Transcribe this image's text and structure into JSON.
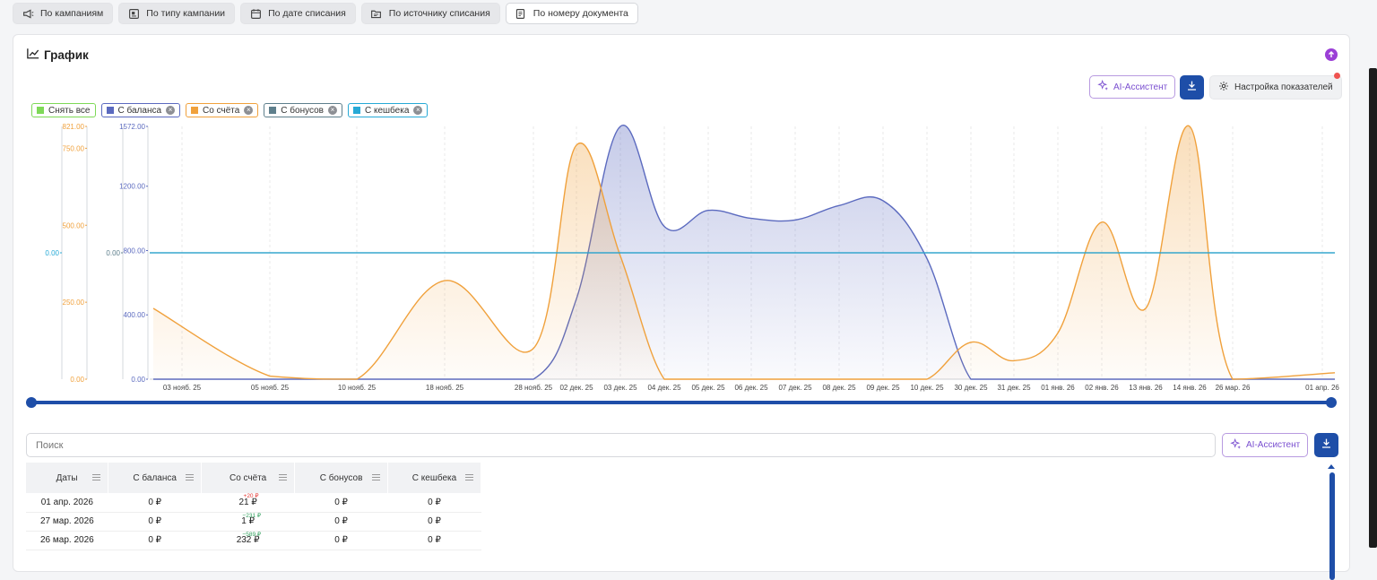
{
  "tabs": [
    {
      "label": "По кампаниям",
      "icon": "megaphone-icon",
      "active": false
    },
    {
      "label": "По типу кампании",
      "icon": "campaign-type-icon",
      "active": false
    },
    {
      "label": "По дате списания",
      "icon": "calendar-icon",
      "active": false
    },
    {
      "label": "По источнику списания",
      "icon": "folder-icon",
      "active": false
    },
    {
      "label": "По номеру документа",
      "icon": "document-icon",
      "active": true
    }
  ],
  "card": {
    "title": "График",
    "ai_label": "AI-Ассистент",
    "settings_label": "Настройка показателей"
  },
  "legend": {
    "deselect_all": "Снять все",
    "items": [
      {
        "label": "С баланса",
        "color": "#5b6abf"
      },
      {
        "label": "Со счёта",
        "color": "#f0a13c"
      },
      {
        "label": "С бонусов",
        "color": "#5e7f8c"
      },
      {
        "label": "С кешбека",
        "color": "#26a9d6"
      }
    ],
    "deselect_color": "#7ed957"
  },
  "chart_data": {
    "type": "area",
    "x": [
      "03 нояб. 25",
      "05 нояб. 25",
      "10 нояб. 25",
      "18 нояб. 25",
      "28 нояб. 25",
      "02 дек. 25",
      "03 дек. 25",
      "04 дек. 25",
      "05 дек. 25",
      "06 дек. 25",
      "07 дек. 25",
      "08 дек. 25",
      "09 дек. 25",
      "10 дек. 25",
      "30 дек. 25",
      "31 дек. 25",
      "01 янв. 26",
      "02 янв. 26",
      "13 янв. 26",
      "14 янв. 26",
      "26 мар. 26",
      "01 апр. 26"
    ],
    "series": [
      {
        "name": "С баланса",
        "color": "#5b6abf",
        "axis": "y2",
        "values": [
          0,
          0,
          0,
          0,
          0,
          500,
          1572,
          950,
          1050,
          1000,
          990,
          1080,
          1110,
          750,
          0,
          0,
          0,
          0,
          0,
          0,
          0,
          0
        ]
      },
      {
        "name": "Со счёта",
        "color": "#f0a13c",
        "axis": "y1",
        "values": [
          230,
          10,
          0,
          320,
          100,
          760,
          400,
          0,
          0,
          0,
          0,
          0,
          0,
          0,
          120,
          60,
          150,
          510,
          230,
          821,
          0,
          21
        ]
      },
      {
        "name": "С бонусов",
        "color": "#5e7f8c",
        "axis": "y3",
        "values": [
          0,
          0,
          0,
          0,
          0,
          0,
          0,
          0,
          0,
          0,
          0,
          0,
          0,
          0,
          0,
          0,
          0,
          0,
          0,
          0,
          0,
          0
        ]
      },
      {
        "name": "С кешбека",
        "color": "#26a9d6",
        "axis": "y4",
        "values": [
          0,
          0,
          0,
          0,
          0,
          0,
          0,
          0,
          0,
          0,
          0,
          0,
          0,
          0,
          0,
          0,
          0,
          0,
          0,
          0,
          0,
          0
        ]
      }
    ],
    "axes": {
      "y1": {
        "ticks": [
          "0.00",
          "250.00",
          "500.00",
          "750.00",
          "821.00"
        ],
        "color": "#f0a13c",
        "max": 821
      },
      "y2": {
        "ticks": [
          "0.00",
          "400.00",
          "800.00",
          "1200.00",
          "1572.00"
        ],
        "color": "#5b6abf",
        "max": 1572
      },
      "y3": {
        "ticks": [
          "0.00"
        ],
        "color": "#5e7f8c"
      },
      "y4": {
        "ticks": [
          "0.00"
        ],
        "color": "#26a9d6"
      }
    }
  },
  "search": {
    "placeholder": "Поиск"
  },
  "table": {
    "columns": [
      "Даты",
      "С баланса",
      "Со счёта",
      "С бонусов",
      "С кешбека"
    ],
    "rows": [
      {
        "date": "01 апр. 2026",
        "balance": "0 ₽",
        "account": "21 ₽",
        "account_delta": "+20 ₽",
        "delta_color": "#e53935",
        "bonus": "0 ₽",
        "cashback": "0 ₽"
      },
      {
        "date": "27 мар. 2026",
        "balance": "0 ₽",
        "account": "1 ₽",
        "account_delta": "−231 ₽",
        "delta_color": "#2e9e5b",
        "bonus": "0 ₽",
        "cashback": "0 ₽"
      },
      {
        "date": "26 мар. 2026",
        "balance": "0 ₽",
        "account": "232 ₽",
        "account_delta": "−589 ₽",
        "delta_color": "#2e9e5b",
        "bonus": "0 ₽",
        "cashback": "0 ₽"
      }
    ]
  }
}
